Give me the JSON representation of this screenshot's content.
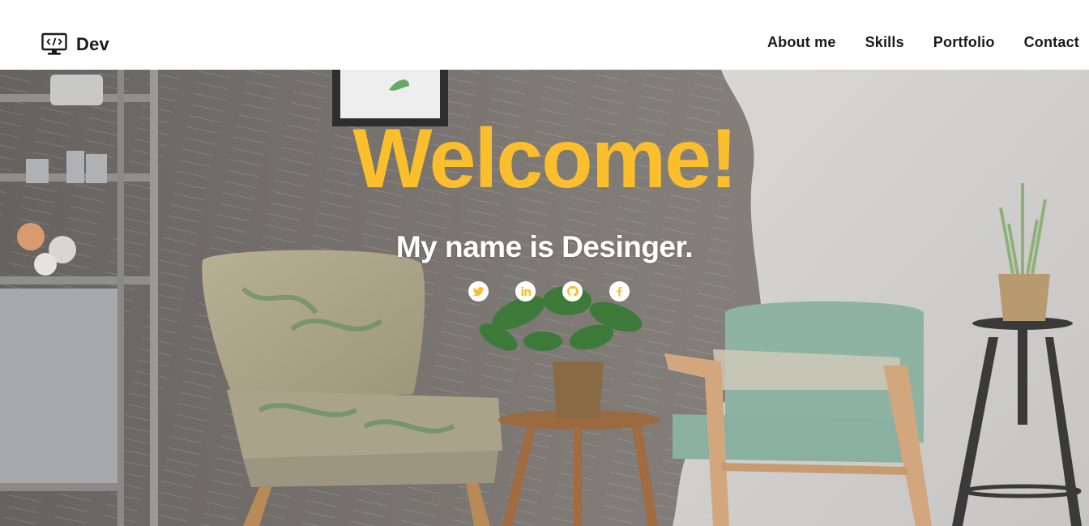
{
  "brand": {
    "name": "Dev",
    "icon": "code-monitor-icon"
  },
  "nav": {
    "items": [
      {
        "label": "About me"
      },
      {
        "label": "Skills"
      },
      {
        "label": "Portfolio"
      },
      {
        "label": "Contact"
      }
    ]
  },
  "hero": {
    "title": "Welcome!",
    "subtitle": "My name is Desinger.",
    "background": "living-room-photo",
    "socials": [
      {
        "icon": "twitter-icon"
      },
      {
        "icon": "linkedin-icon"
      },
      {
        "icon": "github-icon"
      },
      {
        "icon": "facebook-icon"
      }
    ]
  },
  "colors": {
    "accent": "#fbbe2c",
    "text_dark": "#1a1a1a",
    "white": "#ffffff"
  }
}
